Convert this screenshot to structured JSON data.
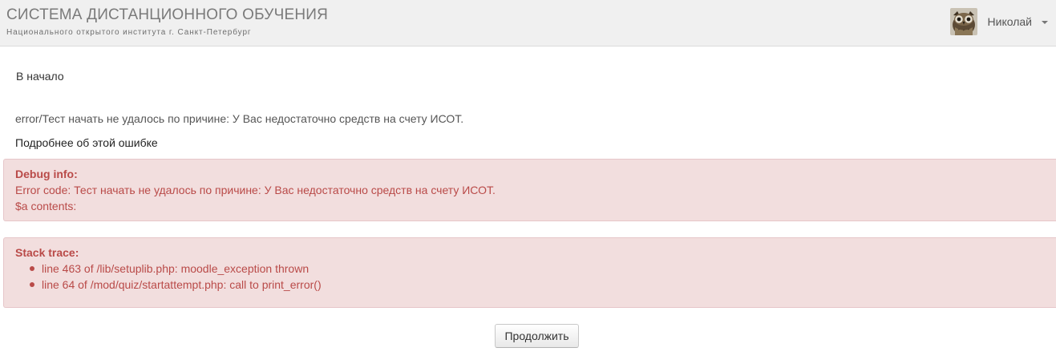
{
  "header": {
    "title": "СИСТЕМА ДИСТАНЦИОННОГО ОБУЧЕНИЯ",
    "subtitle": "Национального открытого института г. Санкт-Петербург",
    "user": {
      "name": "Николай",
      "avatar_icon": "owl-avatar",
      "menu_icon": "caret-down-icon"
    }
  },
  "breadcrumb": {
    "home": "В начало"
  },
  "error": {
    "message": "error/Тест начать не удалось по причине: У Вас недостаточно средств на счету ИСОТ.",
    "more_info_link": "Подробнее об этой ошибке"
  },
  "debug": {
    "heading": "Debug info:",
    "error_code": "Error code: Тест начать не удалось по причине: У Вас недостаточно средств на счету ИСОТ.",
    "contents": "$a contents:"
  },
  "stack": {
    "heading": "Stack trace:",
    "lines": [
      "line 463 of /lib/setuplib.php: moodle_exception thrown",
      "line 64 of /mod/quiz/startattempt.php: call to print_error()"
    ]
  },
  "actions": {
    "continue_label": "Продолжить"
  },
  "colors": {
    "header_bg": "#f0f0f0",
    "alert_bg": "#f2dede",
    "alert_text": "#b94a48"
  }
}
